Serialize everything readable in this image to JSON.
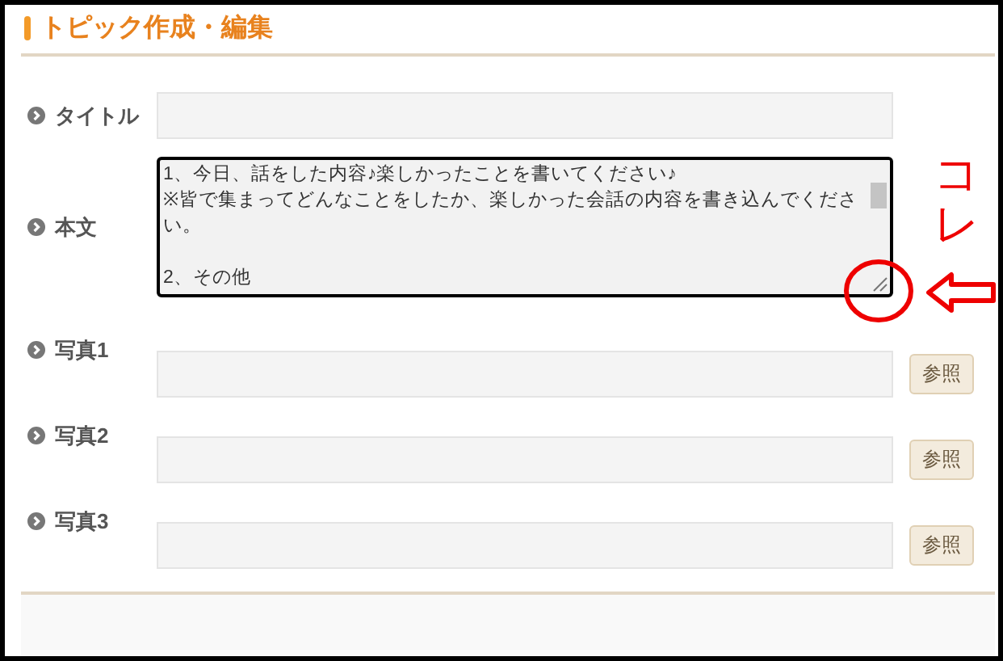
{
  "heading": "トピック作成・編集",
  "fields": [
    {
      "kind": "input",
      "label": "タイトル"
    },
    {
      "kind": "textarea",
      "label": "本文",
      "value": "1、今日、話をした内容♪楽しかったことを書いてください♪\n※皆で集まってどんなことをしたか、楽しかった会話の内容を書き込んでください。\n\n2、その他"
    },
    {
      "kind": "file",
      "label": "写真1",
      "button": "参照"
    },
    {
      "kind": "file",
      "label": "写真2",
      "button": "参照"
    },
    {
      "kind": "file",
      "label": "写真3",
      "button": "参照"
    }
  ],
  "annotation": {
    "text": "コレ"
  }
}
